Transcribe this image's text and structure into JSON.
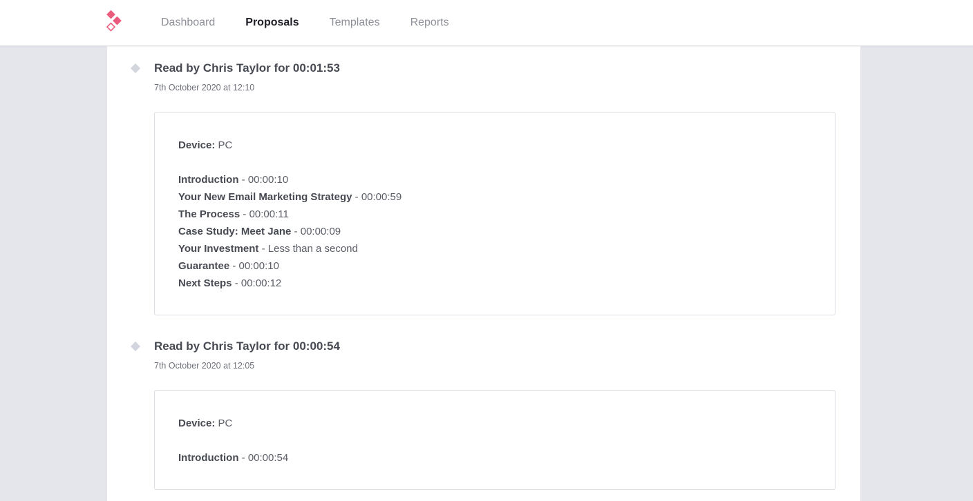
{
  "nav": {
    "items": [
      "Dashboard",
      "Proposals",
      "Templates",
      "Reports"
    ],
    "active": "Proposals"
  },
  "colors": {
    "brand": "#ea5c7e",
    "background": "#e4e6ec",
    "panel": "#ffffff"
  },
  "entries": [
    {
      "title": "Read by Chris Taylor for 00:01:53",
      "date": "7th October 2020 at 12:10",
      "device_label": "Device:",
      "device_value": "PC",
      "sections": [
        {
          "name": "Introduction",
          "time": "00:00:10"
        },
        {
          "name": "Your New Email Marketing Strategy",
          "time": "00:00:59"
        },
        {
          "name": "The Process",
          "time": "00:00:11"
        },
        {
          "name": "Case Study: Meet Jane",
          "time": "00:00:09"
        },
        {
          "name": "Your Investment",
          "time": "Less than a second"
        },
        {
          "name": "Guarantee",
          "time": "00:00:10"
        },
        {
          "name": "Next Steps",
          "time": "00:00:12"
        }
      ]
    },
    {
      "title": "Read by Chris Taylor for 00:00:54",
      "date": "7th October 2020 at 12:05",
      "device_label": "Device:",
      "device_value": "PC",
      "sections": [
        {
          "name": "Introduction",
          "time": "00:00:54"
        }
      ]
    }
  ]
}
